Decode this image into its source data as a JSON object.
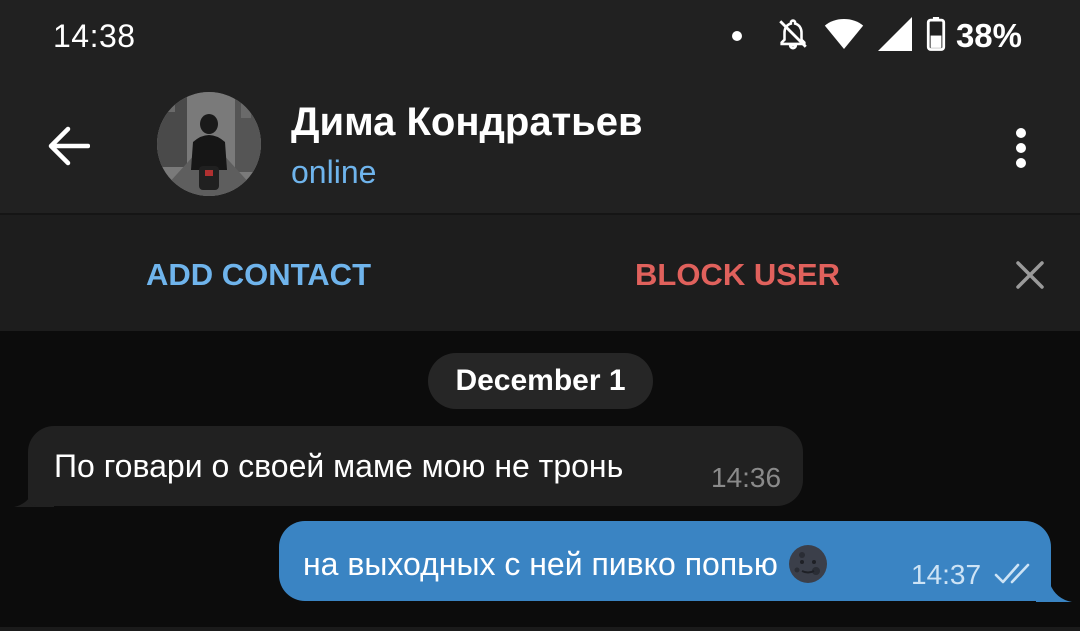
{
  "status_bar": {
    "time": "14:38",
    "battery": "38%",
    "icons": [
      "notification-dot",
      "alarm-off-icon",
      "wifi-icon",
      "signal-icon",
      "battery-icon"
    ]
  },
  "header": {
    "back_icon": "arrow-left-icon",
    "contact_name": "Дима Кондратьев",
    "contact_status": "online",
    "menu_icon": "more-vertical-icon"
  },
  "action_bar": {
    "add_contact": "ADD CONTACT",
    "block_user": "BLOCK USER",
    "close_icon": "close-icon"
  },
  "chat": {
    "date_label": "December 1",
    "messages": [
      {
        "direction": "incoming",
        "text": "По говари о своей маме мою не тронь",
        "time": "14:36"
      },
      {
        "direction": "outgoing",
        "text": "на выходных с ней пивко попью",
        "emoji": "new-moon-face-emoji",
        "time": "14:37",
        "status": "read"
      }
    ]
  },
  "colors": {
    "background": "#0c0c0c",
    "header": "#212121",
    "accent_blue": "#6fb4ec",
    "danger_red": "#e0615c",
    "outgoing_bubble": "#3a84c3",
    "incoming_bubble": "#212121"
  }
}
